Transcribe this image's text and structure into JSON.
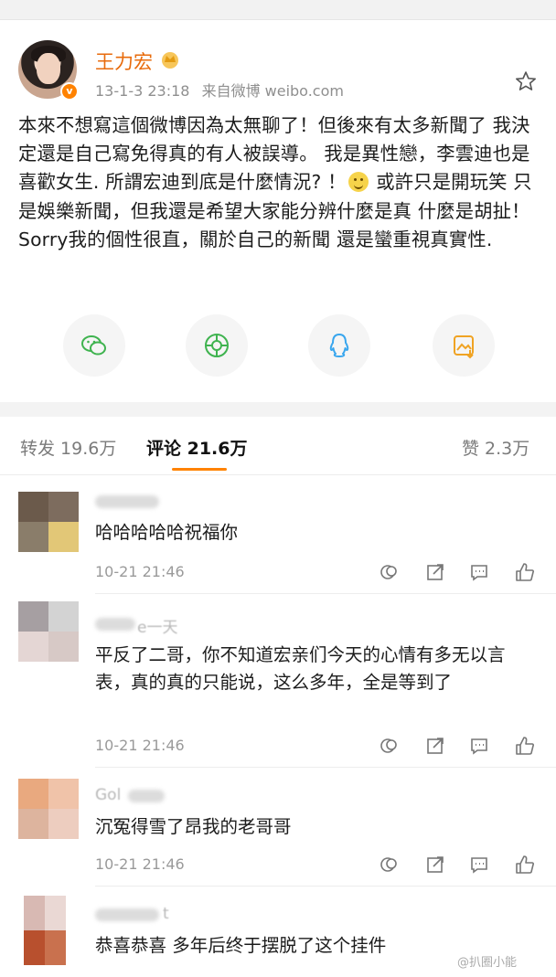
{
  "post": {
    "username": "王力宏",
    "date": "13-1-3 23:18",
    "source": "来自微博 weibo.com",
    "text_before_emoji": "本來不想寫這個微博因為太無聊了！但後來有太多新聞了 我決定還是自己寫免得真的有人被誤導。 我是異性戀，李雲迪也是喜歡女生. 所謂宏迪到底是什麼情況? ！",
    "text_after_emoji": " 或許只是開玩笑 只是娛樂新聞，但我還是希望大家能分辨什麼是真 什麼是胡扯！ Sorry我的個性很直，關於自己的新聞 還是蠻重視真實性.",
    "share_buttons": [
      "wechat-icon",
      "moments-icon",
      "qq-icon",
      "save-image-icon"
    ],
    "colors": {
      "username": "#e86b0c",
      "verified_badge": "#ff8200",
      "tab_accent": "#ff8200"
    }
  },
  "tabs": {
    "repost": "转发 19.6万",
    "comments": "评论 21.6万",
    "likes": "赞 2.3万"
  },
  "comments": [
    {
      "name": "",
      "text": "哈哈哈哈哈祝福你",
      "time": "10-21 21:46"
    },
    {
      "name": "e一天",
      "text": "平反了二哥，你不知道宏亲们今天的心情有多无以言表，真的真的只能说，这么多年，全是等到了",
      "time": "10-21 21:46"
    },
    {
      "name": "Gol",
      "text": "沉冤得雪了昂我的老哥哥",
      "time": "10-21 21:46"
    },
    {
      "name": "t",
      "text": "恭喜恭喜 多年后终于摆脱了这个挂件",
      "time": ""
    }
  ],
  "watermark": "@扒圈小能"
}
